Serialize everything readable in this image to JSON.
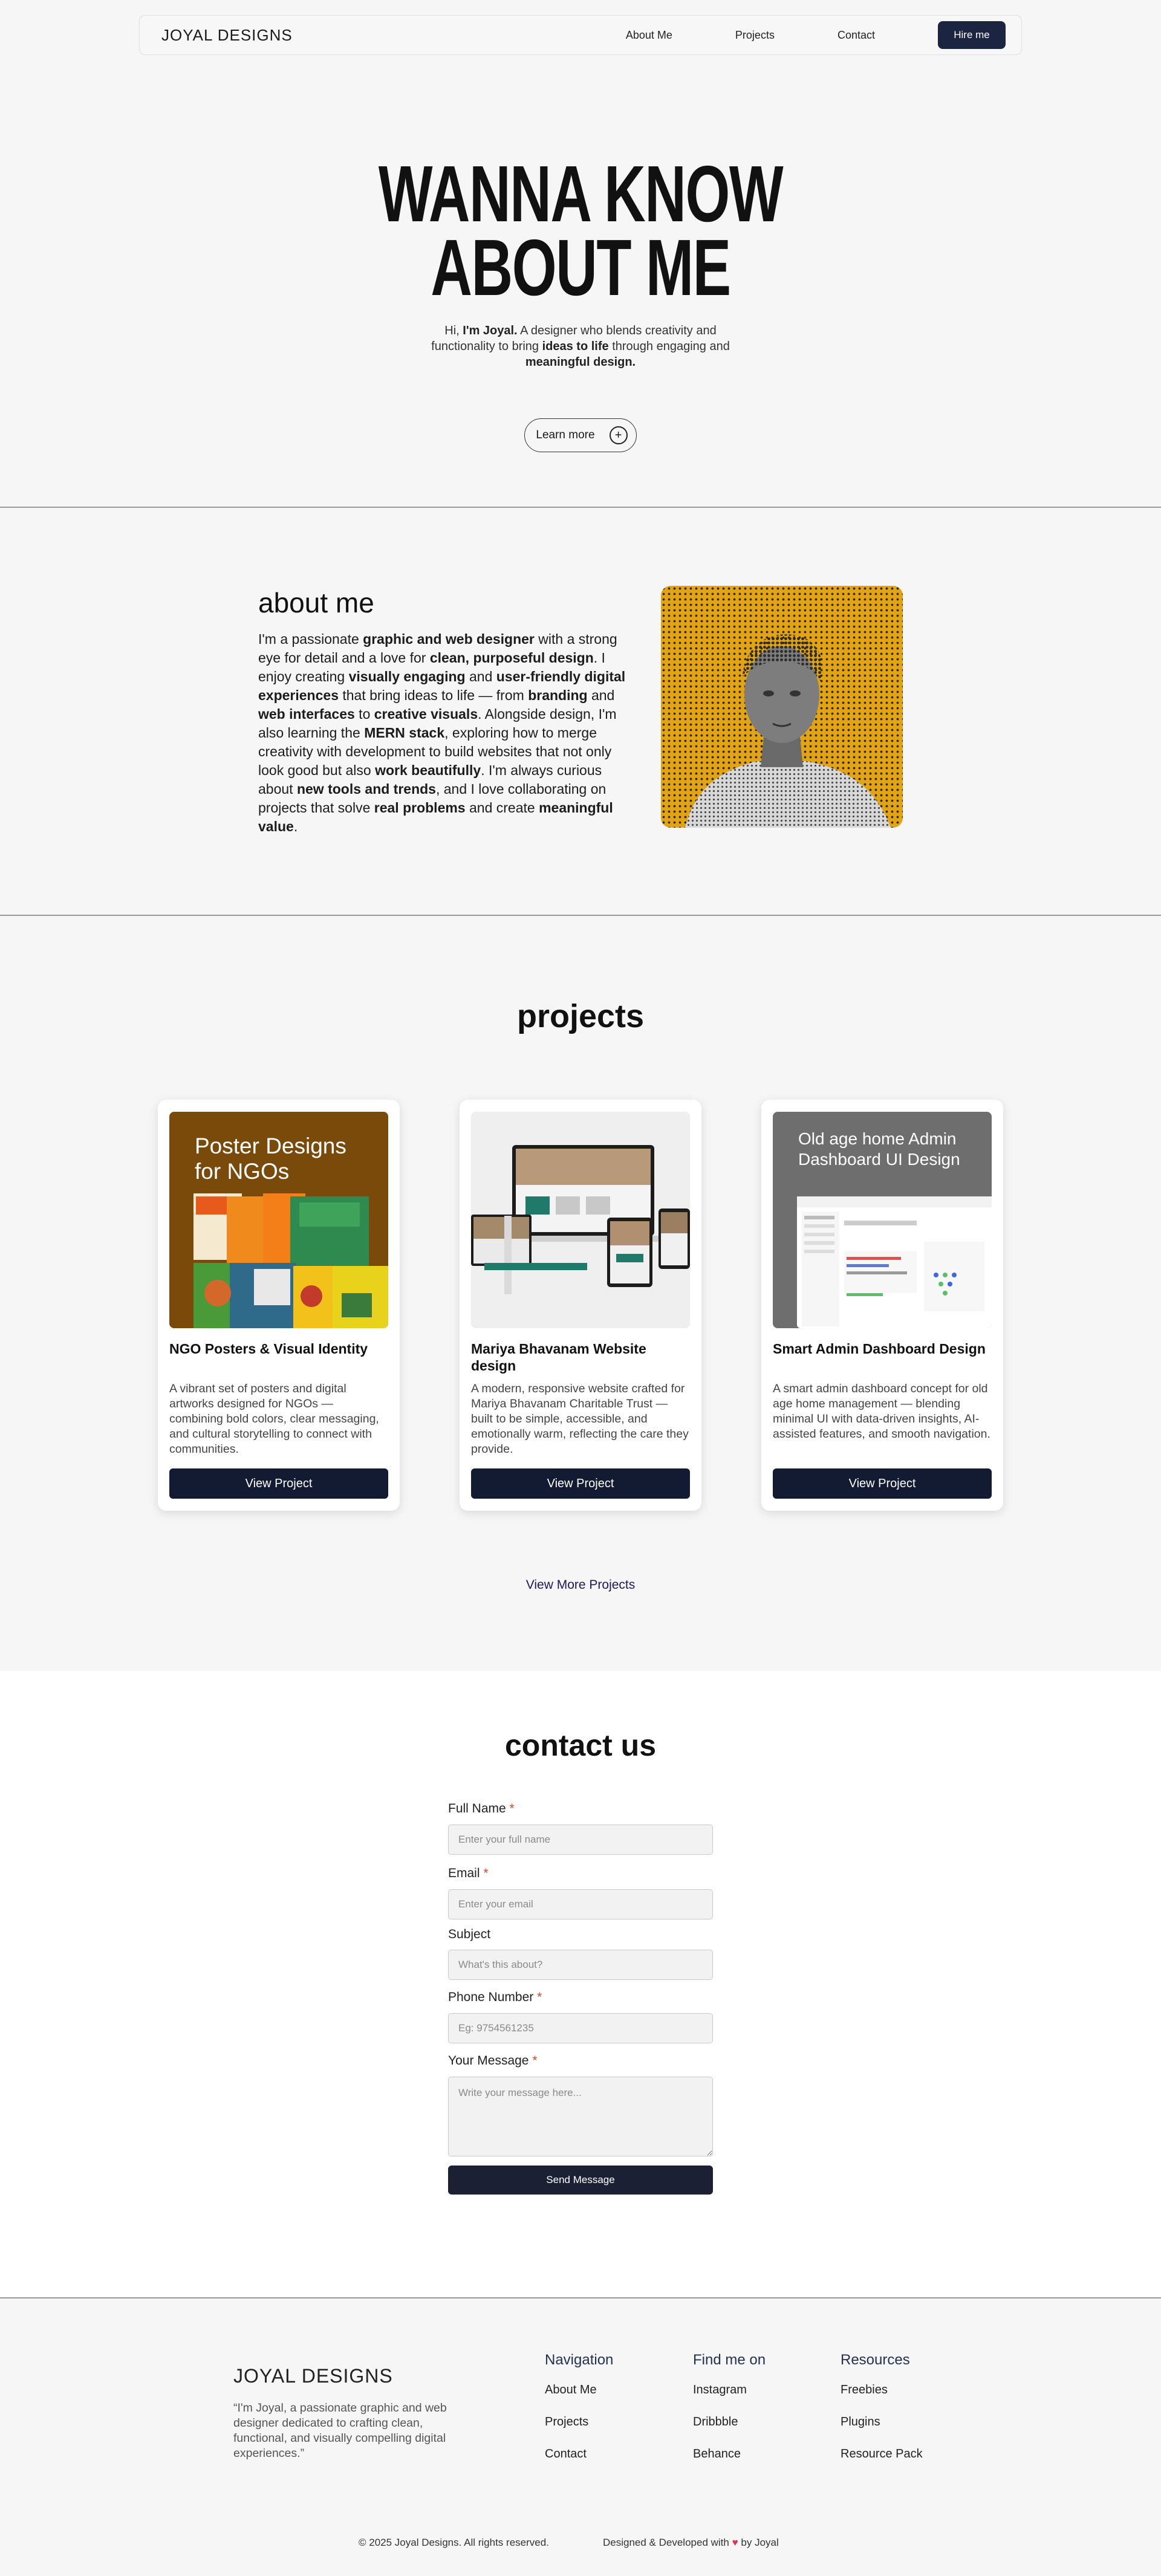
{
  "nav": {
    "brand": "JOYAL DESIGNS",
    "links": [
      "About Me",
      "Projects",
      "Contact"
    ],
    "cta": "Hire me"
  },
  "hero": {
    "title_line1": "WANNA KNOW",
    "title_line2": "ABOUT ME",
    "sub_pre": "Hi, ",
    "sub_name": "I'm Joyal.",
    "sub_mid1": " A designer who blends creativity and",
    "sub_mid2": "functionality to bring ",
    "sub_bold1": "ideas to life",
    "sub_mid3": " through engaging and",
    "sub_bold2": "meaningful design.",
    "button": "Learn more"
  },
  "about": {
    "title": "about me",
    "parts": [
      [
        "I'm a passionate ",
        false
      ],
      [
        "graphic and web designer",
        true
      ],
      [
        " with a strong eye for detail and a love for ",
        false
      ],
      [
        "clean, purposeful design",
        true
      ],
      [
        ". I enjoy creating ",
        false
      ],
      [
        "visually engaging",
        true
      ],
      [
        " and ",
        false
      ],
      [
        "user-friendly digital experiences",
        true
      ],
      [
        " that bring ideas to life — from ",
        false
      ],
      [
        "branding",
        true
      ],
      [
        " and ",
        false
      ],
      [
        "web interfaces",
        true
      ],
      [
        " to ",
        false
      ],
      [
        "creative visuals",
        true
      ],
      [
        ". Alongside design, I'm also learning the ",
        false
      ],
      [
        "MERN stack",
        true
      ],
      [
        ", exploring how to merge creativity with development to build websites that not only look good but also ",
        false
      ],
      [
        "work beautifully",
        true
      ],
      [
        ". I'm always curious about ",
        false
      ],
      [
        "new tools and trends",
        true
      ],
      [
        ", and I love collaborating on projects that solve ",
        false
      ],
      [
        "real problems",
        true
      ],
      [
        " and create ",
        false
      ],
      [
        "meaningful value",
        true
      ],
      [
        ".",
        false
      ]
    ]
  },
  "projects": {
    "title": "projects",
    "items": [
      {
        "thumb_title": "Poster Designs for NGOs",
        "title": "NGO Posters & Visual Identity",
        "desc": "A vibrant set of posters and digital artworks designed for NGOs — combining bold colors, clear messaging, and cultural storytelling to connect with communities.",
        "button": "View Project"
      },
      {
        "thumb_title": "",
        "title": "Mariya Bhavanam Website design",
        "desc": "A modern, responsive website crafted for Mariya Bhavanam Charitable Trust — built to be simple, accessible, and emotionally warm, reflecting the care they provide.",
        "button": "View Project"
      },
      {
        "thumb_title": "Old age home Admin Dashboard UI Design",
        "title": "Smart Admin Dashboard Design",
        "desc": "A smart admin dashboard concept for old age home management — blending minimal UI with data-driven insights, AI-assisted features, and smooth navigation.",
        "button": "View Project"
      }
    ],
    "view_more": "View More Projects"
  },
  "contact": {
    "title": "contact us",
    "fields": [
      {
        "label": "Full Name",
        "required": "*",
        "placeholder": "Enter your full name"
      },
      {
        "label": "Email",
        "required": "*",
        "placeholder": "Enter your email"
      },
      {
        "label": "Subject",
        "required": "",
        "placeholder": "What's this about?"
      },
      {
        "label": "Phone Number",
        "required": "*",
        "placeholder": "Eg: 9754561235"
      },
      {
        "label": "Your Message",
        "required": "*",
        "placeholder": "Write your message here..."
      }
    ],
    "submit": "Send Message"
  },
  "footer": {
    "brand": "JOYAL DESIGNS",
    "quote": "“I'm Joyal, a passionate graphic and web designer dedicated to crafting clean, functional, and visually compelling digital experiences.”",
    "navigation": {
      "title": "Navigation",
      "links": [
        "About Me",
        "Projects",
        "Contact"
      ]
    },
    "social": {
      "title": "Find me on",
      "links": [
        "Instagram",
        "Dribbble",
        "Behance"
      ]
    },
    "resources": {
      "title": "Resources",
      "links": [
        "Freebies",
        "Plugins",
        "Resource Pack"
      ]
    },
    "copyright": "© 2025 Joyal Designs. All rights reserved.",
    "credit_pre": "Designed & Developed with ",
    "credit_post": " by Joyal"
  },
  "colors": {
    "accent": "#1b2440",
    "button_dark": "#131b33",
    "required": "#e0442b",
    "photo_bg": "#e3a413"
  }
}
